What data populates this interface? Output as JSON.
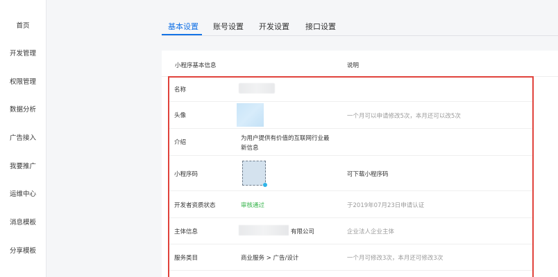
{
  "sidebar": {
    "items": [
      {
        "label": "首页"
      },
      {
        "label": "开发管理"
      },
      {
        "label": "权限管理"
      },
      {
        "label": "数据分析"
      },
      {
        "label": "广告接入"
      },
      {
        "label": "我要推广"
      },
      {
        "label": "运维中心"
      },
      {
        "label": "消息模板"
      },
      {
        "label": "分享模板"
      }
    ]
  },
  "tabs": [
    {
      "label": "基本设置",
      "active": true
    },
    {
      "label": "账号设置",
      "active": false
    },
    {
      "label": "开发设置",
      "active": false
    },
    {
      "label": "接口设置",
      "active": false
    }
  ],
  "table": {
    "header": {
      "col1": "小程序基本信息",
      "col2": "说明"
    },
    "rows": [
      {
        "label": "名称",
        "value": "",
        "desc": ""
      },
      {
        "label": "头像",
        "value": "",
        "desc": "一个月可以申请修改5次，本月还可以改5次"
      },
      {
        "label": "介绍",
        "value": "为用户提供有价值的互联网行业最新信息",
        "desc": ""
      },
      {
        "label": "小程序码",
        "value": "",
        "desc": "可下载小程序码"
      },
      {
        "label": "开发者资质状态",
        "value": "审核通过",
        "desc": "于2019年07月23日申请认证"
      },
      {
        "label": "主体信息",
        "value": "有限公司",
        "desc": "企业法人企业主体"
      },
      {
        "label": "服务类目",
        "value": "商业服务 > 广告/设计",
        "desc": "一个月可修改3次，本月还可修改3次"
      }
    ]
  },
  "intro_lines": [
    "为用户提供有价值的互联网行业最",
    "新信息"
  ],
  "colors": {
    "accent": "#1473e6",
    "highlight": "#e0423b",
    "success": "#35b34a"
  }
}
